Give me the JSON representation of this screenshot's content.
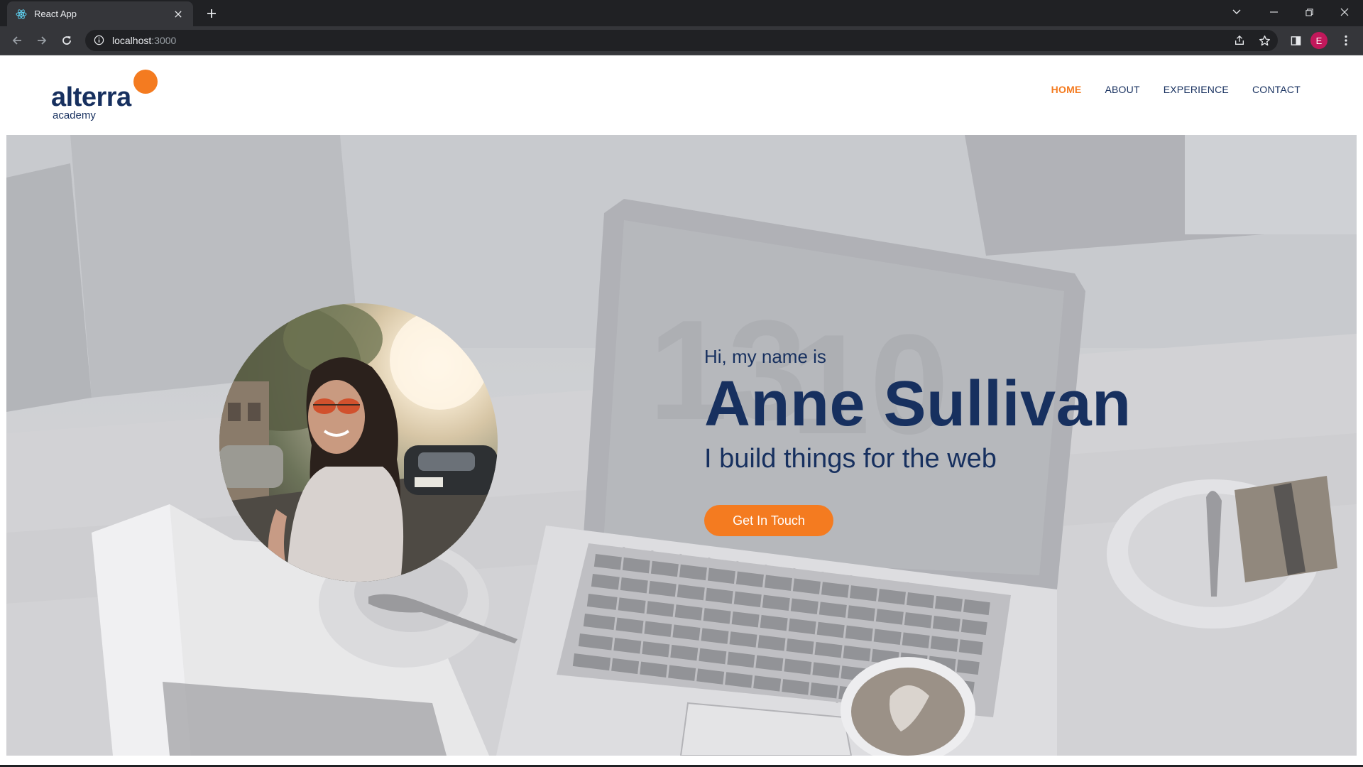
{
  "browser": {
    "tab_title": "React App",
    "url_host": "localhost",
    "url_port": ":3000",
    "profile_initial": "E",
    "icons": [
      "react-favicon",
      "close-icon",
      "plus-icon",
      "chevron-down-icon",
      "minimize-icon",
      "restore-icon",
      "close-window-icon",
      "back-arrow-icon",
      "forward-arrow-icon",
      "reload-icon",
      "info-icon",
      "share-icon",
      "star-icon",
      "side-panel-icon",
      "more-vert-icon"
    ]
  },
  "site": {
    "logo": {
      "word": "alterra",
      "sub": "academy"
    },
    "nav": [
      {
        "label": "HOME",
        "active": true
      },
      {
        "label": "ABOUT",
        "active": false
      },
      {
        "label": "EXPERIENCE",
        "active": false
      },
      {
        "label": "CONTACT",
        "active": false
      }
    ],
    "hero": {
      "greeting": "Hi, my name is",
      "name": "Anne Sullivan",
      "tagline": "I build things for the web",
      "cta_label": "Get In Touch"
    },
    "colors": {
      "accent": "#f47b20",
      "navy": "#17305f"
    }
  }
}
